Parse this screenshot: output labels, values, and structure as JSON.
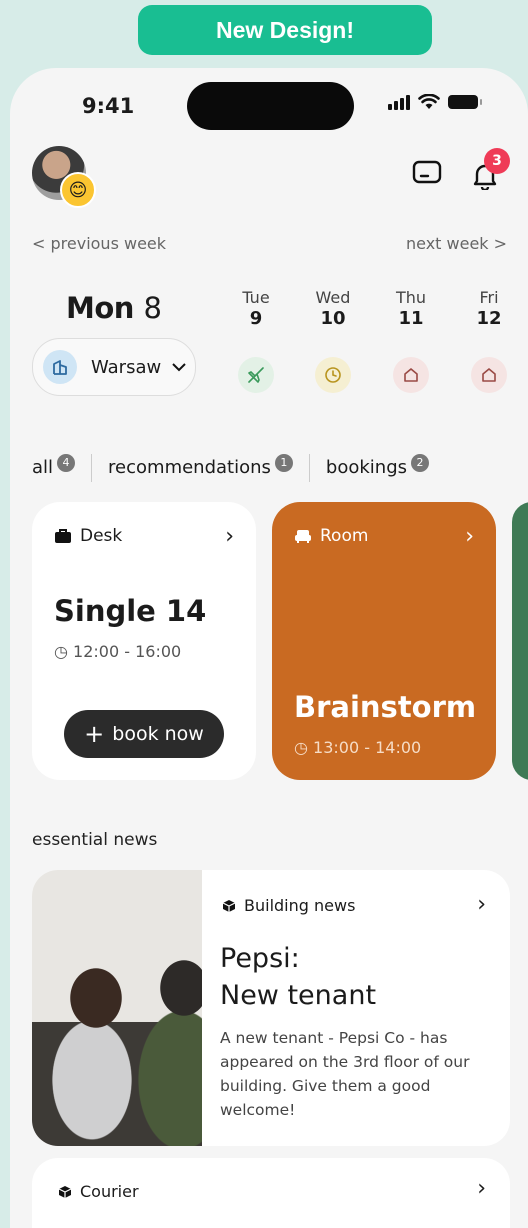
{
  "banner": "New Design!",
  "status": {
    "time": "9:41"
  },
  "notifications": {
    "count": "3"
  },
  "week_nav": {
    "previous": "< previous week",
    "next": "next week >"
  },
  "today": {
    "weekday": "Mon",
    "day": "8"
  },
  "location": {
    "city": "Warsaw"
  },
  "days": [
    {
      "weekday": "Tue",
      "day": "9",
      "icon": "airplane-icon",
      "color": "#e3f1e6"
    },
    {
      "weekday": "Wed",
      "day": "10",
      "icon": "clock-icon",
      "color": "#f5efd2"
    },
    {
      "weekday": "Thu",
      "day": "11",
      "icon": "home-icon",
      "color": "#f5e4e3"
    },
    {
      "weekday": "Fri",
      "day": "12",
      "icon": "home-icon",
      "color": "#f5e4e3"
    }
  ],
  "filters": [
    {
      "label": "all",
      "count": "4"
    },
    {
      "label": "recommendations",
      "count": "1"
    },
    {
      "label": "bookings",
      "count": "2"
    }
  ],
  "cards": {
    "desk": {
      "type": "Desk",
      "title": "Single 14",
      "time": "12:00 - 16:00",
      "button": "book now"
    },
    "room": {
      "type": "Room",
      "title": "Brainstorm",
      "time": "13:00 - 14:00",
      "color": "#c96a22"
    }
  },
  "section_title": "essential news",
  "news": [
    {
      "type": "Building news",
      "title_line1": "Pepsi:",
      "title_line2": "New tenant",
      "description": "A new tenant - Pepsi Co - has appeared on the 3rd floor of our building. Give them a good welcome!"
    },
    {
      "type": "Courier"
    }
  ]
}
